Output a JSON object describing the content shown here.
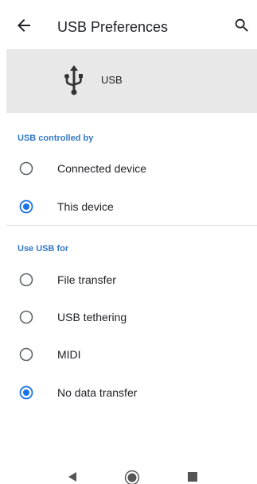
{
  "header": {
    "title": "USB Preferences",
    "back_icon": "arrow-left-icon",
    "search_icon": "search-icon"
  },
  "hero": {
    "icon": "usb-icon",
    "label": "USB"
  },
  "controlled_by": {
    "header": "USB controlled by",
    "options": [
      {
        "label": "Connected device",
        "selected": false
      },
      {
        "label": "This device",
        "selected": true
      }
    ]
  },
  "use_for": {
    "header": "Use USB for",
    "options": [
      {
        "label": "File transfer",
        "selected": false
      },
      {
        "label": "USB tethering",
        "selected": false
      },
      {
        "label": "MIDI",
        "selected": false
      },
      {
        "label": "No data transfer",
        "selected": true
      }
    ]
  },
  "nav": {
    "back_icon": "nav-back-icon",
    "home_icon": "nav-home-icon",
    "recents_icon": "nav-recents-icon"
  },
  "colors": {
    "accent": "#1a73e8",
    "section_header": "#3479c6",
    "hero_background": "#e8e8e8",
    "text": "#202124",
    "radio_unselected": "#5f6368"
  }
}
